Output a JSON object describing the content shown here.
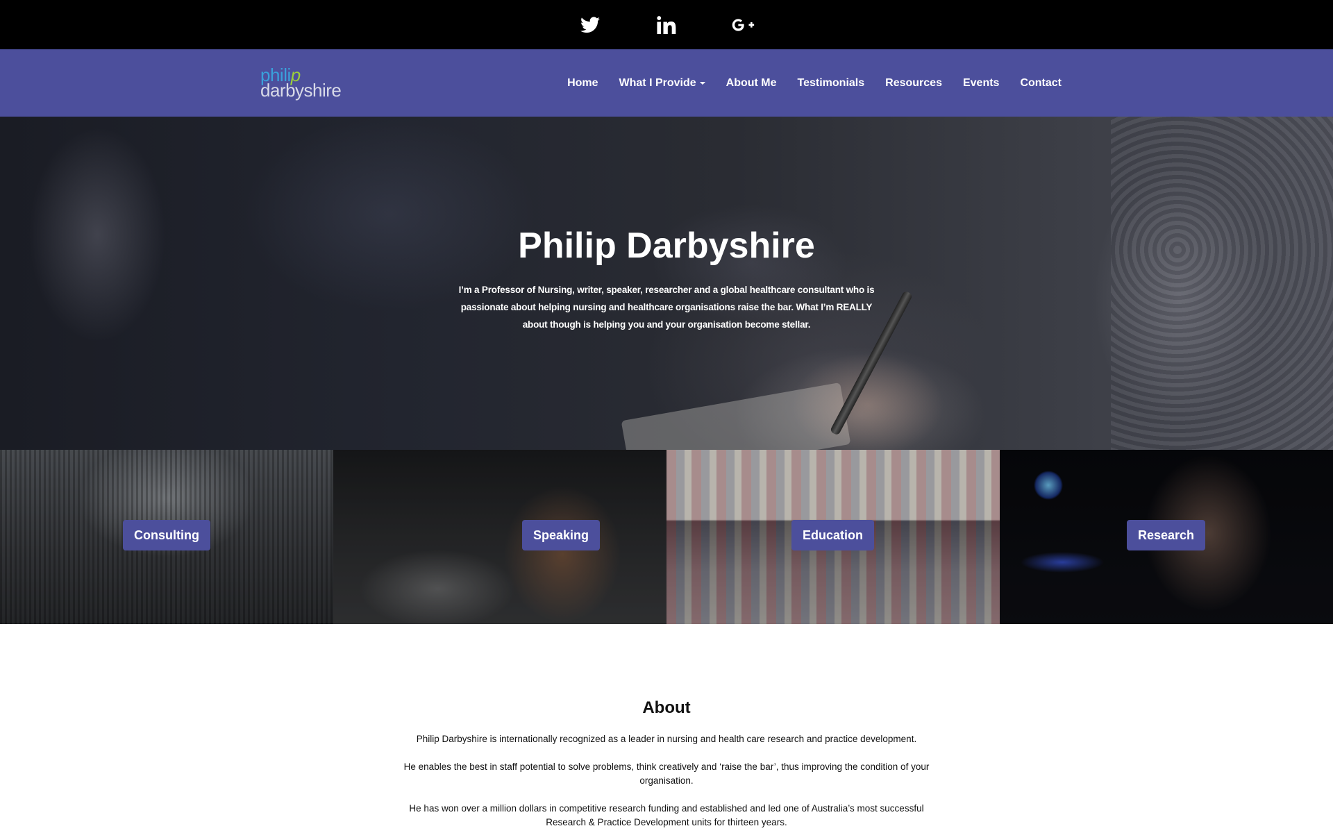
{
  "social": {
    "twitter_icon": "twitter-icon",
    "linkedin_icon": "linkedin-icon",
    "googleplus_icon": "google-plus-icon"
  },
  "logo": {
    "line1_a": "phili",
    "line1_b": "p",
    "line2": "darbyshire"
  },
  "nav": {
    "home": "Home",
    "what_i_provide": "What I Provide",
    "about_me": "About Me",
    "testimonials": "Testimonials",
    "resources": "Resources",
    "events": "Events",
    "contact": "Contact"
  },
  "hero": {
    "title": "Philip Darbyshire",
    "subtitle": "I’m a Professor of Nursing, writer, speaker, researcher and a global healthcare consultant who is passionate about helping nursing and healthcare organisations raise the bar. What I’m REALLY about though is helping you and your organisation become stellar."
  },
  "services": {
    "consulting": "Consulting",
    "speaking": "Speaking",
    "education": "Education",
    "research": "Research"
  },
  "about": {
    "title": "About",
    "p1": "Philip Darbyshire is internationally recognized as a leader in nursing and health care research and practice development.",
    "p2": "He enables the best in staff potential to solve problems, think creatively and ‘raise the bar’, thus improving the condition of your organisation.",
    "p3": "He has won over a million dollars in competitive research funding and established and led one of Australia’s most successful Research & Practice Development units for thirteen years."
  },
  "colors": {
    "brand": "#4c4f9c",
    "topbar": "#000000",
    "logo_blue": "#3aa0db",
    "logo_green": "#9ccf3a"
  }
}
